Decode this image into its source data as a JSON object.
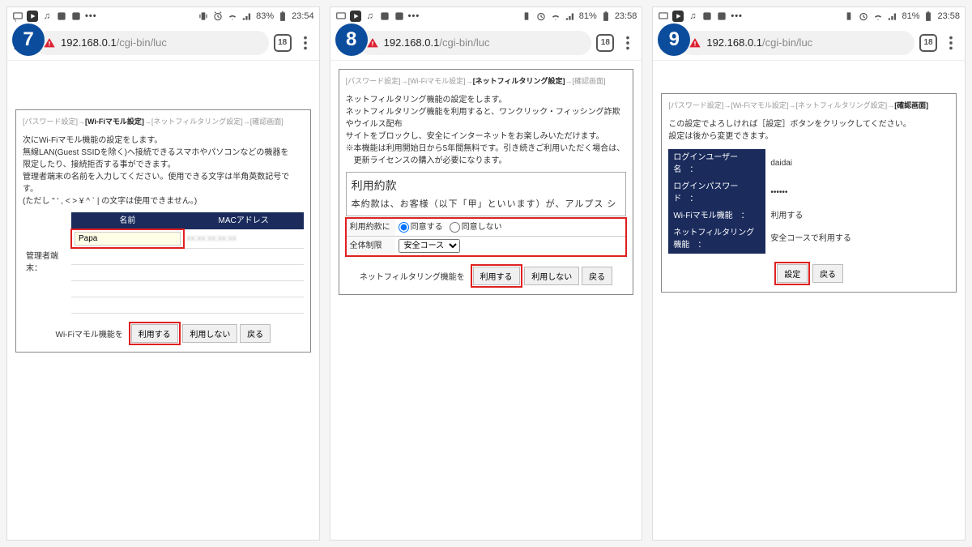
{
  "steps": [
    "7",
    "8",
    "9"
  ],
  "status": {
    "battery7": "83%",
    "time7": "23:54",
    "battery8": "81%",
    "time8": "23:58",
    "battery9": "81%",
    "time9": "23:58"
  },
  "addr": {
    "host": "192.168.0.1",
    "path": "/cgi-bin/luc",
    "tabs": "18"
  },
  "bc": {
    "s1": "[パスワード設定]",
    "arrow": "→",
    "s2": "[Wi-Fiマモル設定]",
    "s3": "[ネットフィルタリング設定]",
    "s4": "[確認画面]"
  },
  "p7": {
    "l1": "次にWi-Fiマモル機能の設定をします。",
    "l2": "無線LAN(Guest SSIDを除く)へ接続できるスマホやパソコンなどの機器を",
    "l3": "限定したり、接続拒否する事ができます。",
    "l4": "管理者端末の名前を入力してください。使用できる文字は半角英数記号です。",
    "l5": "(ただし \" ' , < > ¥ ^ ` | の文字は使用できません。)",
    "rowlabel": "管理者端末：",
    "th_name": "名前",
    "th_mac": "MACアドレス",
    "name_value": "Papa",
    "btn_label": "Wi-Fiマモル機能を",
    "use": "利用する",
    "notuse": "利用しない",
    "back": "戻る"
  },
  "p8": {
    "d1": "ネットフィルタリング機能の設定をします。",
    "d2": "ネットフィルタリング機能を利用すると、ワンクリック・フィッシング詐欺やウイルス配布",
    "d3": "サイトをブロックし、安全にインターネットをお楽しみいただけます。",
    "d4": "※本機能は利用開始日から5年間無料です。引き続きご利用いただく場合は、",
    "d5": "　更新ライセンスの購入が必要になります。",
    "terms_title": "利用約款",
    "terms_body": "本約款は、お客様（以下「甲」といいます）が、アルプス シ",
    "agree_label": "利用約款に",
    "agree_yes": "同意する",
    "agree_no": "同意しない",
    "policy_label": "全体制限",
    "policy_value": "安全コース",
    "btn_label": "ネットフィルタリング機能を",
    "use": "利用する",
    "notuse": "利用しない",
    "back": "戻る"
  },
  "p9": {
    "msg1": "この設定でよろしければ［設定］ボタンをクリックしてください。",
    "msg2": "設定は後から変更できます。",
    "k1": "ログインユーザー名　：",
    "v1": "daidai",
    "k2": "ログインパスワード　：",
    "v2": "••••••",
    "k3": "Wi-Fiマモル機能　：",
    "v3": "利用する",
    "k4": "ネットフィルタリング機能　：",
    "v4": "安全コースで利用する",
    "set": "設定",
    "back": "戻る"
  }
}
